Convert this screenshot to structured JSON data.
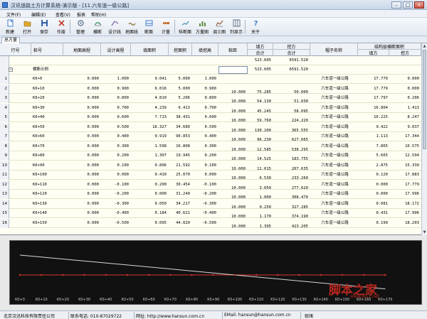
{
  "window": {
    "title": "汉讯道路土方计算系统-演示版 - [11.六车道一级公路]",
    "min": "–",
    "max": "□",
    "close": "×"
  },
  "menu": [
    "文件(F)",
    "编辑(E)",
    "查看(V)",
    "报表",
    "帮助(H)"
  ],
  "toolbar": [
    {
      "label": "新建",
      "icon": "new-file-icon",
      "color": "#3f7fcf"
    },
    {
      "label": "打开",
      "icon": "open-folder-icon",
      "color": "#e0a82e"
    },
    {
      "label": "保存",
      "icon": "save-disk-icon",
      "color": "#2f5fa0"
    },
    {
      "label": "作废",
      "icon": "discard-icon",
      "color": "#c0392b"
    },
    {
      "label": "管理",
      "icon": "manage-icon",
      "color": "#6a7f95"
    },
    {
      "label": "横断",
      "icon": "cross-section-icon",
      "color": "#2e8b57"
    },
    {
      "label": "设计线",
      "icon": "design-line-icon",
      "color": "#7a5ea8"
    },
    {
      "label": "地面线",
      "icon": "ground-line-icon",
      "color": "#8a6a2e"
    },
    {
      "label": "断面",
      "icon": "section-icon",
      "color": "#3f7fcf"
    },
    {
      "label": "计量",
      "icon": "measure-icon",
      "color": "#c46a2a"
    },
    {
      "label": "纵断面",
      "icon": "longitudinal-icon",
      "color": "#3a8fb0"
    },
    {
      "label": "方量图",
      "icon": "volume-chart-icon",
      "color": "#5a8a3a"
    },
    {
      "label": "调土图",
      "icon": "earth-chart-icon",
      "color": "#8e5a3a"
    },
    {
      "label": "列显示",
      "icon": "column-display-icon",
      "color": "#5f6f85"
    },
    {
      "label": "关于",
      "icon": "about-icon",
      "color": "#3f7fcf"
    }
  ],
  "tab": "总方量",
  "headers": {
    "rownum": "行号",
    "station": "桩号",
    "ground_elev": "地面高程",
    "design_elev": "设计高程",
    "fill_area": "填面积",
    "cut_area": "挖面积",
    "fill_cut_height": "填挖高",
    "pile_dist": "桩距",
    "fill_vol": "填方",
    "cut_vol": "挖方",
    "total": "合计",
    "template": "帽子名称",
    "struct_group": "结构层横断面积",
    "struct_fill": "填方",
    "struct_cut": "挖方"
  },
  "summary": {
    "fill_total": "523.605",
    "cut_total": "6591.520"
  },
  "group_row": {
    "name": "横断示例",
    "fill_total": "523.605",
    "cut_total": "6591.520"
  },
  "rows": [
    {
      "n": "1",
      "st": "K0+0",
      "ge": "0.000",
      "de": "1.000",
      "fa": "9.041",
      "ca": "5.000",
      "fh": "1.000",
      "dist": "",
      "fv": "",
      "cv": "",
      "tpl": "六车道一级公路",
      "sf": "17.779",
      "sc": "0.000"
    },
    {
      "n": "2",
      "st": "K0+10",
      "ge": "0.000",
      "de": "0.900",
      "fa": "6.016",
      "ca": "5.000",
      "fh": "0.900",
      "dist": "10.000",
      "fv": "75.285",
      "cv": "50.000",
      "tpl": "六车道一级公路",
      "sf": "17.779",
      "sc": "0.000"
    },
    {
      "n": "3",
      "st": "K0+20",
      "ge": "0.000",
      "de": "0.800",
      "fa": "4.810",
      "ca": "5.206",
      "fh": "0.800",
      "dist": "10.000",
      "fv": "54.130",
      "cv": "51.030",
      "tpl": "六车道一级公路",
      "sf": "17.797",
      "sc": "0.206"
    },
    {
      "n": "4",
      "st": "K0+30",
      "ge": "0.000",
      "de": "0.700",
      "fa": "4.239",
      "ca": "6.413",
      "fh": "0.700",
      "dist": "10.000",
      "fv": "45.245",
      "cv": "58.095",
      "tpl": "六车道一级公路",
      "sf": "16.804",
      "sc": "1.413"
    },
    {
      "n": "5",
      "st": "K0+40",
      "ge": "0.000",
      "de": "0.600",
      "fa": "7.713",
      "ca": "38.431",
      "fh": "0.600",
      "dist": "10.000",
      "fv": "59.760",
      "cv": "224.220",
      "tpl": "六车道一级公路",
      "sf": "10.225",
      "sc": "8.247"
    },
    {
      "n": "6",
      "st": "K0+50",
      "ge": "0.000",
      "de": "0.500",
      "fa": "18.327",
      "ca": "34.680",
      "fh": "0.500",
      "dist": "10.000",
      "fv": "130.200",
      "cv": "365.555",
      "tpl": "六车道一级公路",
      "sf": "9.422",
      "sc": "9.037"
    },
    {
      "n": "7",
      "st": "K0+60",
      "ge": "0.000",
      "de": "0.400",
      "fa": "0.919",
      "ca": "90.853",
      "fh": "0.400",
      "dist": "10.000",
      "fv": "96.230",
      "cv": "627.665",
      "tpl": "六车道一级公路",
      "sf": "1.113",
      "sc": "17.344"
    },
    {
      "n": "8",
      "st": "K0+70",
      "ge": "0.000",
      "de": "0.300",
      "fa": "1.598",
      "ca": "16.808",
      "fh": "0.300",
      "dist": "10.000",
      "fv": "12.585",
      "cv": "538.295",
      "tpl": "六车道一级公路",
      "sf": "7.865",
      "sc": "10.575"
    },
    {
      "n": "9",
      "st": "K0+80",
      "ge": "0.000",
      "de": "0.200",
      "fa": "1.307",
      "ca": "19.945",
      "fh": "0.200",
      "dist": "10.000",
      "fv": "14.525",
      "cv": "183.755",
      "tpl": "六车道一级公路",
      "sf": "5.665",
      "sc": "12.594"
    },
    {
      "n": "10",
      "st": "K0+90",
      "ge": "0.000",
      "de": "0.100",
      "fa": "0.896",
      "ca": "21.592",
      "fh": "0.100",
      "dist": "10.000",
      "fv": "11.015",
      "cv": "207.635",
      "tpl": "六车道一级公路",
      "sf": "2.875",
      "sc": "15.339"
    },
    {
      "n": "11",
      "st": "K0+100",
      "ge": "0.000",
      "de": "0.000",
      "fa": "0.410",
      "ca": "25.070",
      "fh": "0.000",
      "dist": "10.000",
      "fv": "6.530",
      "cv": "233.260",
      "tpl": "六车道一级公路",
      "sf": "0.120",
      "sc": "17.883"
    },
    {
      "n": "12",
      "st": "K0+110",
      "ge": "0.000",
      "de": "-0.100",
      "fa": "0.200",
      "ca": "30.454",
      "fh": "-0.100",
      "dist": "10.000",
      "fv": "3.050",
      "cv": "277.620",
      "tpl": "六车道一级公路",
      "sf": "0.000",
      "sc": "17.779"
    },
    {
      "n": "13",
      "st": "K0+120",
      "ge": "0.000",
      "de": "-0.200",
      "fa": "0.000",
      "ca": "31.240",
      "fh": "-0.200",
      "dist": "10.000",
      "fv": "1.000",
      "cv": "308.470",
      "tpl": "六车道一级公路",
      "sf": "0.000",
      "sc": "17.996"
    },
    {
      "n": "14",
      "st": "K0+130",
      "ge": "0.000",
      "de": "-0.300",
      "fa": "0.050",
      "ca": "34.217",
      "fh": "-0.300",
      "dist": "10.000",
      "fv": "0.250",
      "cv": "327.285",
      "tpl": "六车道一级公路",
      "sf": "0.081",
      "sc": "18.172"
    },
    {
      "n": "15",
      "st": "K0+140",
      "ge": "0.000",
      "de": "-0.400",
      "fa": "0.184",
      "ca": "40.621",
      "fh": "-0.400",
      "dist": "10.000",
      "fv": "1.170",
      "cv": "374.190",
      "tpl": "六车道一级公路",
      "sf": "0.431",
      "sc": "17.996"
    },
    {
      "n": "16",
      "st": "K0+150",
      "ge": "0.000",
      "de": "-0.500",
      "fa": "0.095",
      "ca": "44.020",
      "fh": "-0.500",
      "dist": "10.000",
      "fv": "1.395",
      "cv": "423.205",
      "tpl": "六车道一级公路",
      "sf": "0.199",
      "sc": "18.203"
    }
  ],
  "profile": {
    "stations": [
      "K0+0",
      "K0+10",
      "K0+20",
      "K0+30",
      "K0+40",
      "K0+50",
      "K0+60",
      "K0+70",
      "K0+80",
      "K0+90",
      "K0+100",
      "K0+110",
      "K0+120",
      "K0+130",
      "K0+140",
      "K0+150",
      "K0+160",
      "K0+170"
    ],
    "design_start": 1.0,
    "design_step": -0.1,
    "ground": 0.0,
    "ground_color": "#d9342a",
    "design_color": "#d8d8d8"
  },
  "watermark": {
    "big": "脚本之家",
    "small": "www.jb51.net"
  },
  "status": {
    "company": "北京汉迅科技有限责任公司",
    "phone": "联系电话: 010-87029722",
    "web": "网址: http://www.hansun.com.cn",
    "email": "EMail: hansun@hansun.com.cn",
    "state": "就绪"
  }
}
